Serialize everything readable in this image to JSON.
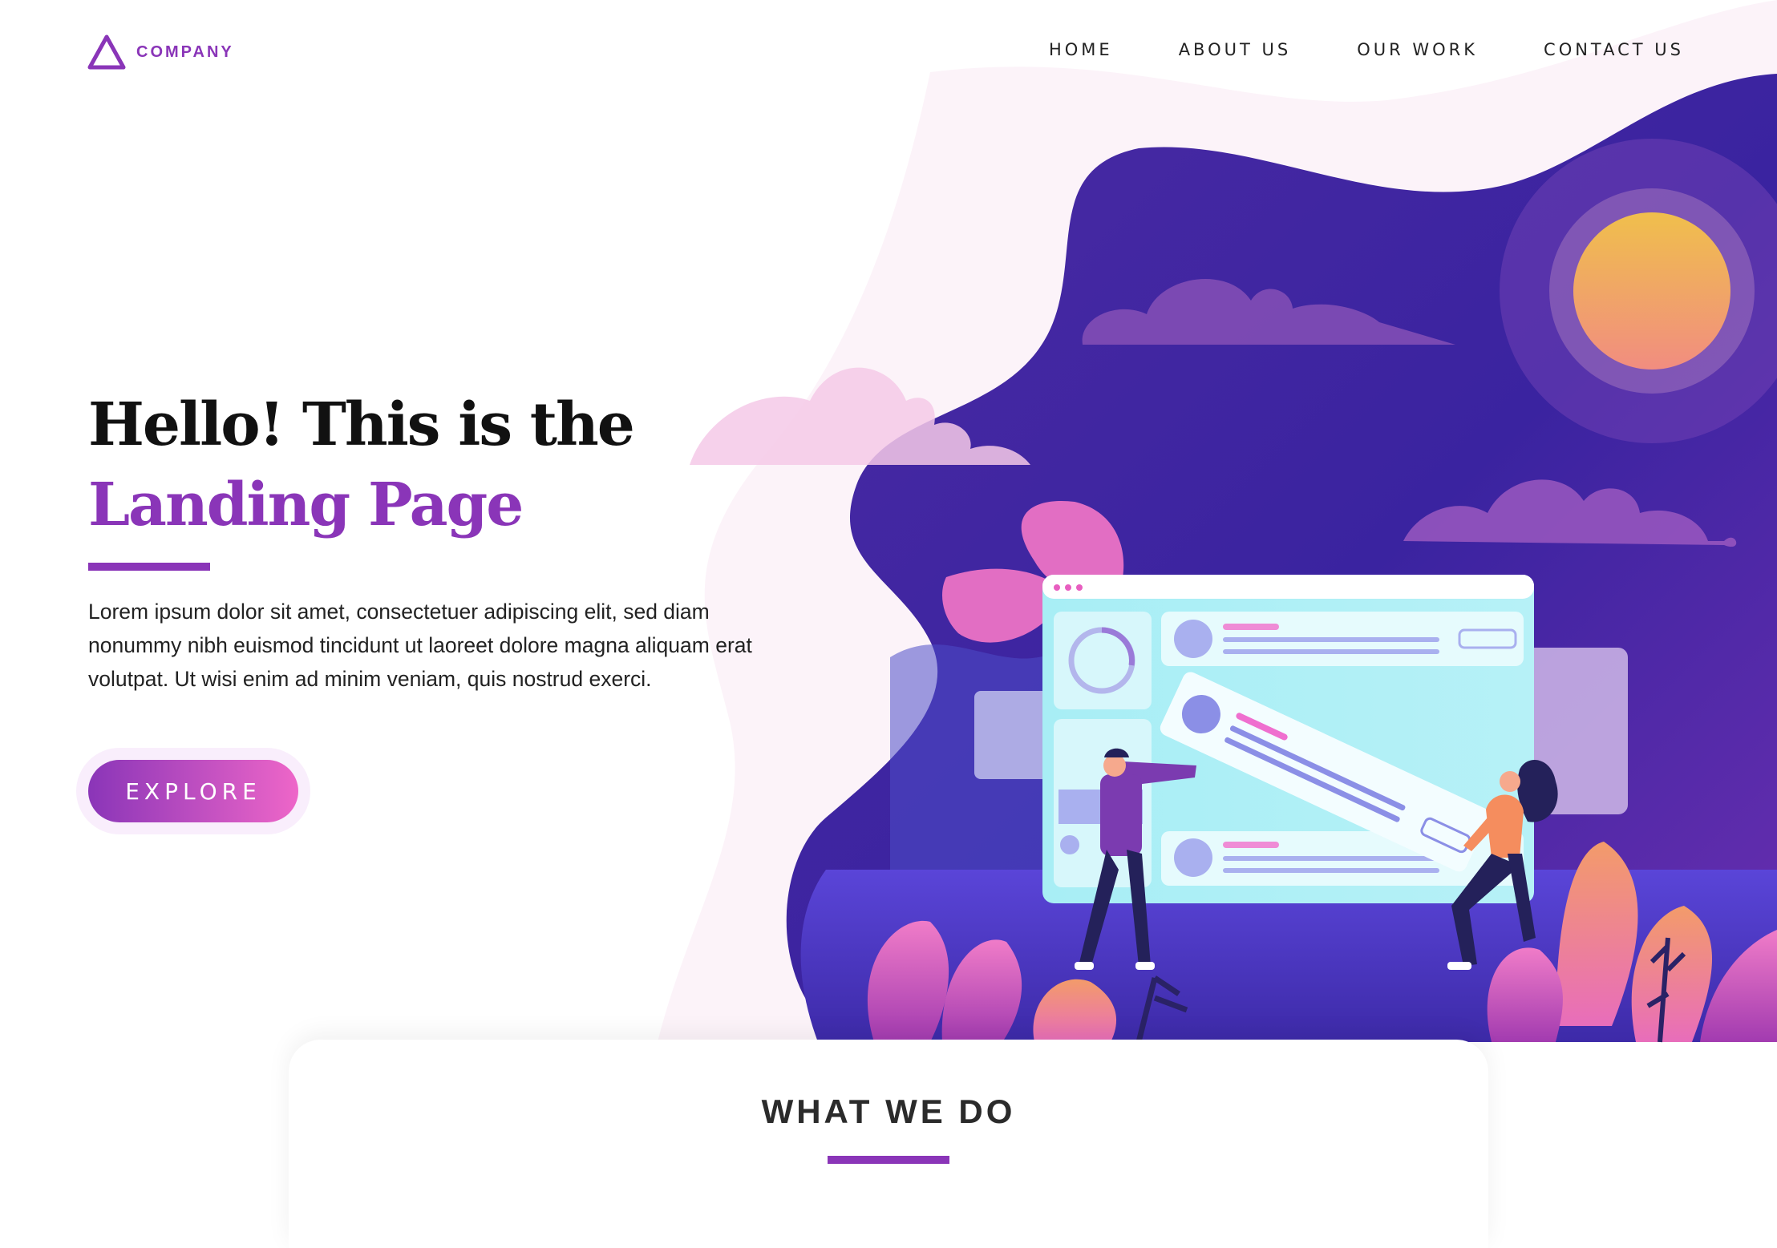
{
  "brand": {
    "name": "COMPANY",
    "color": "#8a35b8",
    "logo_icon": "triangle-icon"
  },
  "nav": [
    "HOME",
    "ABOUT US",
    "OUR WORK",
    "CONTACT US"
  ],
  "hero": {
    "line1": "Hello! This is the",
    "line2": "Landing Page",
    "description": "Lorem ipsum dolor sit amet, consectetuer adipiscing elit, sed diam nonummy nibh euismod tincidunt ut laoreet dolore magna aliquam erat volutpat. Ut wisi enim ad minim veniam, quis nostrud exerci.",
    "cta": "EXPLORE"
  },
  "section": {
    "title": "WHAT WE DO"
  },
  "colors": {
    "accent": "#8a35b8",
    "pink": "#ee66c8",
    "deep_purple": "#3b1f99",
    "sun": "#f2a15e"
  }
}
